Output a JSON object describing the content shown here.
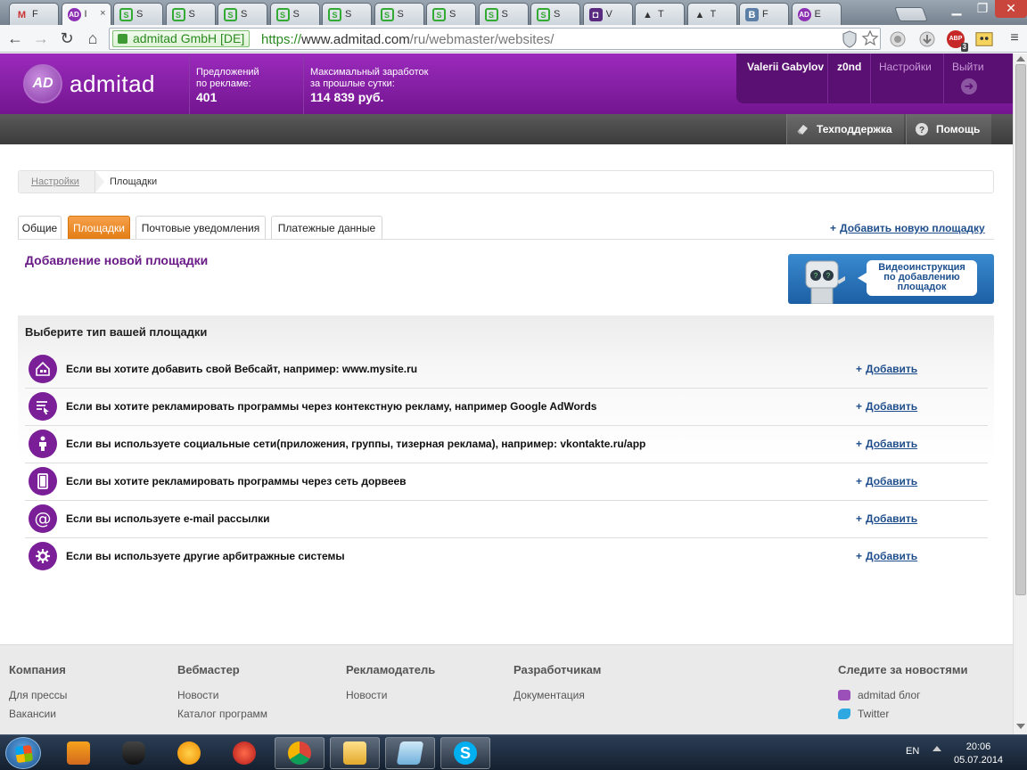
{
  "browser": {
    "tabs": [
      {
        "icon": "gmail-icon",
        "glyph": "M",
        "title": "F",
        "cls": "gm"
      },
      {
        "icon": "admitad-icon",
        "glyph": "AD",
        "title": "I",
        "cls": "ad",
        "active": true
      },
      {
        "icon": "site-icon",
        "glyph": "S",
        "title": "S",
        "cls": "s"
      },
      {
        "icon": "site-icon",
        "glyph": "S",
        "title": "S",
        "cls": "s"
      },
      {
        "icon": "site-icon",
        "glyph": "S",
        "title": "S",
        "cls": "s"
      },
      {
        "icon": "site-icon",
        "glyph": "S",
        "title": "S",
        "cls": "s"
      },
      {
        "icon": "site-icon",
        "glyph": "S",
        "title": "S",
        "cls": "s"
      },
      {
        "icon": "site-icon",
        "glyph": "S",
        "title": "S",
        "cls": "s"
      },
      {
        "icon": "site-icon",
        "glyph": "S",
        "title": "S",
        "cls": "s"
      },
      {
        "icon": "site-icon",
        "glyph": "S",
        "title": "S",
        "cls": "s"
      },
      {
        "icon": "site-icon",
        "glyph": "S",
        "title": "S",
        "cls": "s"
      },
      {
        "icon": "deviantart-icon",
        "glyph": "◘",
        "title": "V",
        "cls": "dv"
      },
      {
        "icon": "wizard-hat-icon",
        "glyph": "▲",
        "title": "T",
        "cls": "wz"
      },
      {
        "icon": "wizard-hat-icon",
        "glyph": "▲",
        "title": "T",
        "cls": "wz"
      },
      {
        "icon": "vk-icon",
        "glyph": "B",
        "title": "F",
        "cls": "vk"
      },
      {
        "icon": "admitad-icon",
        "glyph": "AD",
        "title": "E",
        "cls": "ad"
      }
    ],
    "close_glyph": "×",
    "ev_label": "admitad GmbH [DE]",
    "url_scheme": "https://",
    "url_host": "www.admitad.com",
    "url_path": "/ru/webmaster/websites/",
    "abp_badge": "ABP",
    "abp_count": "3"
  },
  "header": {
    "logo_mark": "AD",
    "logo_text": "admitad",
    "offers_label_1": "Предложений",
    "offers_label_2": "по рекламе:",
    "offers_value": "401",
    "max_label_1": "Максимальный заработок",
    "max_label_2": "за прошлые сутки:",
    "max_value": "114 839 руб.",
    "user_name": "Valerii Gabylov",
    "user_login": "z0nd",
    "settings": "Настройки",
    "logout": "Выйти",
    "logout_arrow": "➜"
  },
  "greybar": {
    "support": "Техподдержка",
    "help": "Помощь"
  },
  "breadcrumb": {
    "parent": "Настройки",
    "current": "Площадки"
  },
  "tabs": [
    {
      "label": "Общие",
      "name": "tab-general"
    },
    {
      "label": "Площадки",
      "name": "tab-websites",
      "active": true
    },
    {
      "label": "Почтовые уведомления",
      "name": "tab-email-notifications"
    },
    {
      "label": "Платежные данные",
      "name": "tab-payment-data"
    }
  ],
  "add_new_site": "Добавить новую площадку",
  "plus_glyph": "+",
  "section_title": "Добавление новой площадки",
  "video": {
    "line1": "Видеоинструкция",
    "line2": "по добавлению",
    "line3": "площадок"
  },
  "types": {
    "title": "Выберите тип вашей площадки",
    "add_label": "Добавить",
    "rows": [
      {
        "icon": "house-icon",
        "text": "Если вы хотите добавить свой Вебсайт, например: www.mysite.ru"
      },
      {
        "icon": "context-ads-icon",
        "text": "Если вы хотите рекламировать программы через контекстную рекламу, например Google AdWords"
      },
      {
        "icon": "people-icon",
        "text": "Если вы используете социальные сети(приложения, группы, тизерная реклама), например: vkontakte.ru/app"
      },
      {
        "icon": "doorway-icon",
        "text": "Если вы хотите рекламировать программы через сеть дорвеев"
      },
      {
        "icon": "at-icon",
        "text": "Если вы используете e-mail рассылки"
      },
      {
        "icon": "gear-icon",
        "text": "Если вы используете другие арбитражные системы"
      }
    ]
  },
  "footer": {
    "cols": [
      {
        "title": "Компания",
        "links": [
          "Для прессы",
          "Вакансии"
        ]
      },
      {
        "title": "Вебмастер",
        "links": [
          "Новости",
          "Каталог программ"
        ]
      },
      {
        "title": "Рекламодатель",
        "links": [
          "Новости"
        ]
      },
      {
        "title": "Разработчикам",
        "links": [
          "Документация"
        ]
      }
    ],
    "news_title": "Следите за новостями",
    "news_links": [
      {
        "label": "admitad блог",
        "icon": "admitad-blog-icon"
      },
      {
        "label": "Twitter",
        "icon": "twitter-icon"
      }
    ]
  },
  "taskbar": {
    "lang": "EN",
    "time": "20:06",
    "date": "05.07.2014"
  },
  "colors": {
    "brand_purple": "#8d2fb2",
    "accent_orange": "#e37d15",
    "link_blue": "#1f4e8c"
  }
}
